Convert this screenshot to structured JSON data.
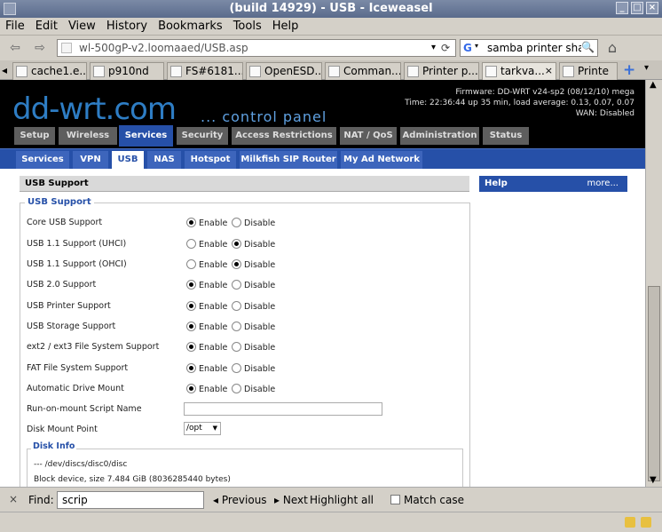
{
  "window": {
    "title": "(build 14929) - USB - Iceweasel",
    "min": "_",
    "max": "□",
    "close": "×"
  },
  "menu": [
    "File",
    "Edit",
    "View",
    "History",
    "Bookmarks",
    "Tools",
    "Help"
  ],
  "nav": {
    "back": "⇦",
    "forward": "⇨",
    "url": "wl-500gP-v2.loomaaed/USB.asp",
    "dropdown": "▾",
    "reload": "⟳",
    "search_engine": "G",
    "search_dd": "▾",
    "search_text": "samba printer shar",
    "search_btn": "🔍",
    "home": "⌂"
  },
  "tabs": [
    {
      "label": "cache1.e..."
    },
    {
      "label": "p910nd"
    },
    {
      "label": "FS#6181..."
    },
    {
      "label": "OpenESD..."
    },
    {
      "label": "Comman..."
    },
    {
      "label": "Printer p..."
    },
    {
      "label": "tarkva..."
    },
    {
      "label": "Printe"
    }
  ],
  "tab_controls": {
    "scroll_left": "◂",
    "new_tab": "+",
    "list": "▾",
    "close": "×"
  },
  "router": {
    "logo": "dd-wrt.com",
    "subtitle": "... control panel",
    "firmware": "Firmware: DD-WRT v24-sp2 (08/12/10) mega",
    "time": "Time: 22:36:44 up 35 min, load average: 0.13, 0.07, 0.07",
    "wan": "WAN: Disabled",
    "main_tabs": [
      "Setup",
      "Wireless",
      "Services",
      "Security",
      "Access Restrictions",
      "NAT / QoS",
      "Administration",
      "Status"
    ],
    "sub_tabs": [
      "Services",
      "VPN",
      "USB",
      "NAS",
      "Hotspot",
      "Milkfish SIP Router",
      "My Ad Network"
    ],
    "section_title": "USB Support",
    "help_title": "Help",
    "help_more": "more...",
    "fieldset_legend": "USB Support",
    "enable": "Enable",
    "disable": "Disable",
    "rows": [
      {
        "label": "Core USB Support",
        "enabled": true
      },
      {
        "label": "USB 1.1 Support (UHCI)",
        "enabled": false
      },
      {
        "label": "USB 1.1 Support (OHCI)",
        "enabled": false
      },
      {
        "label": "USB 2.0 Support",
        "enabled": true
      },
      {
        "label": "USB Printer Support",
        "enabled": true
      },
      {
        "label": "USB Storage Support",
        "enabled": true
      },
      {
        "label": "ext2 / ext3 File System Support",
        "enabled": true
      },
      {
        "label": "FAT File System Support",
        "enabled": true
      },
      {
        "label": "Automatic Drive Mount",
        "enabled": true
      }
    ],
    "run_script_label": "Run-on-mount Script Name",
    "run_script_value": "",
    "disk_mount_label": "Disk Mount Point",
    "disk_mount_value": "/opt",
    "disk_info_legend": "Disk Info",
    "disk_lines": [
      "--- /dev/discs/disc0/disc",
      "Block device, size 7.484 GiB (8036285440 bytes)"
    ]
  },
  "find": {
    "close": "×",
    "label": "Find:",
    "value": "scrip",
    "previous": "◂ Previous",
    "next": "▸ Next",
    "highlight": "Highlight all",
    "match_case": "Match case"
  }
}
